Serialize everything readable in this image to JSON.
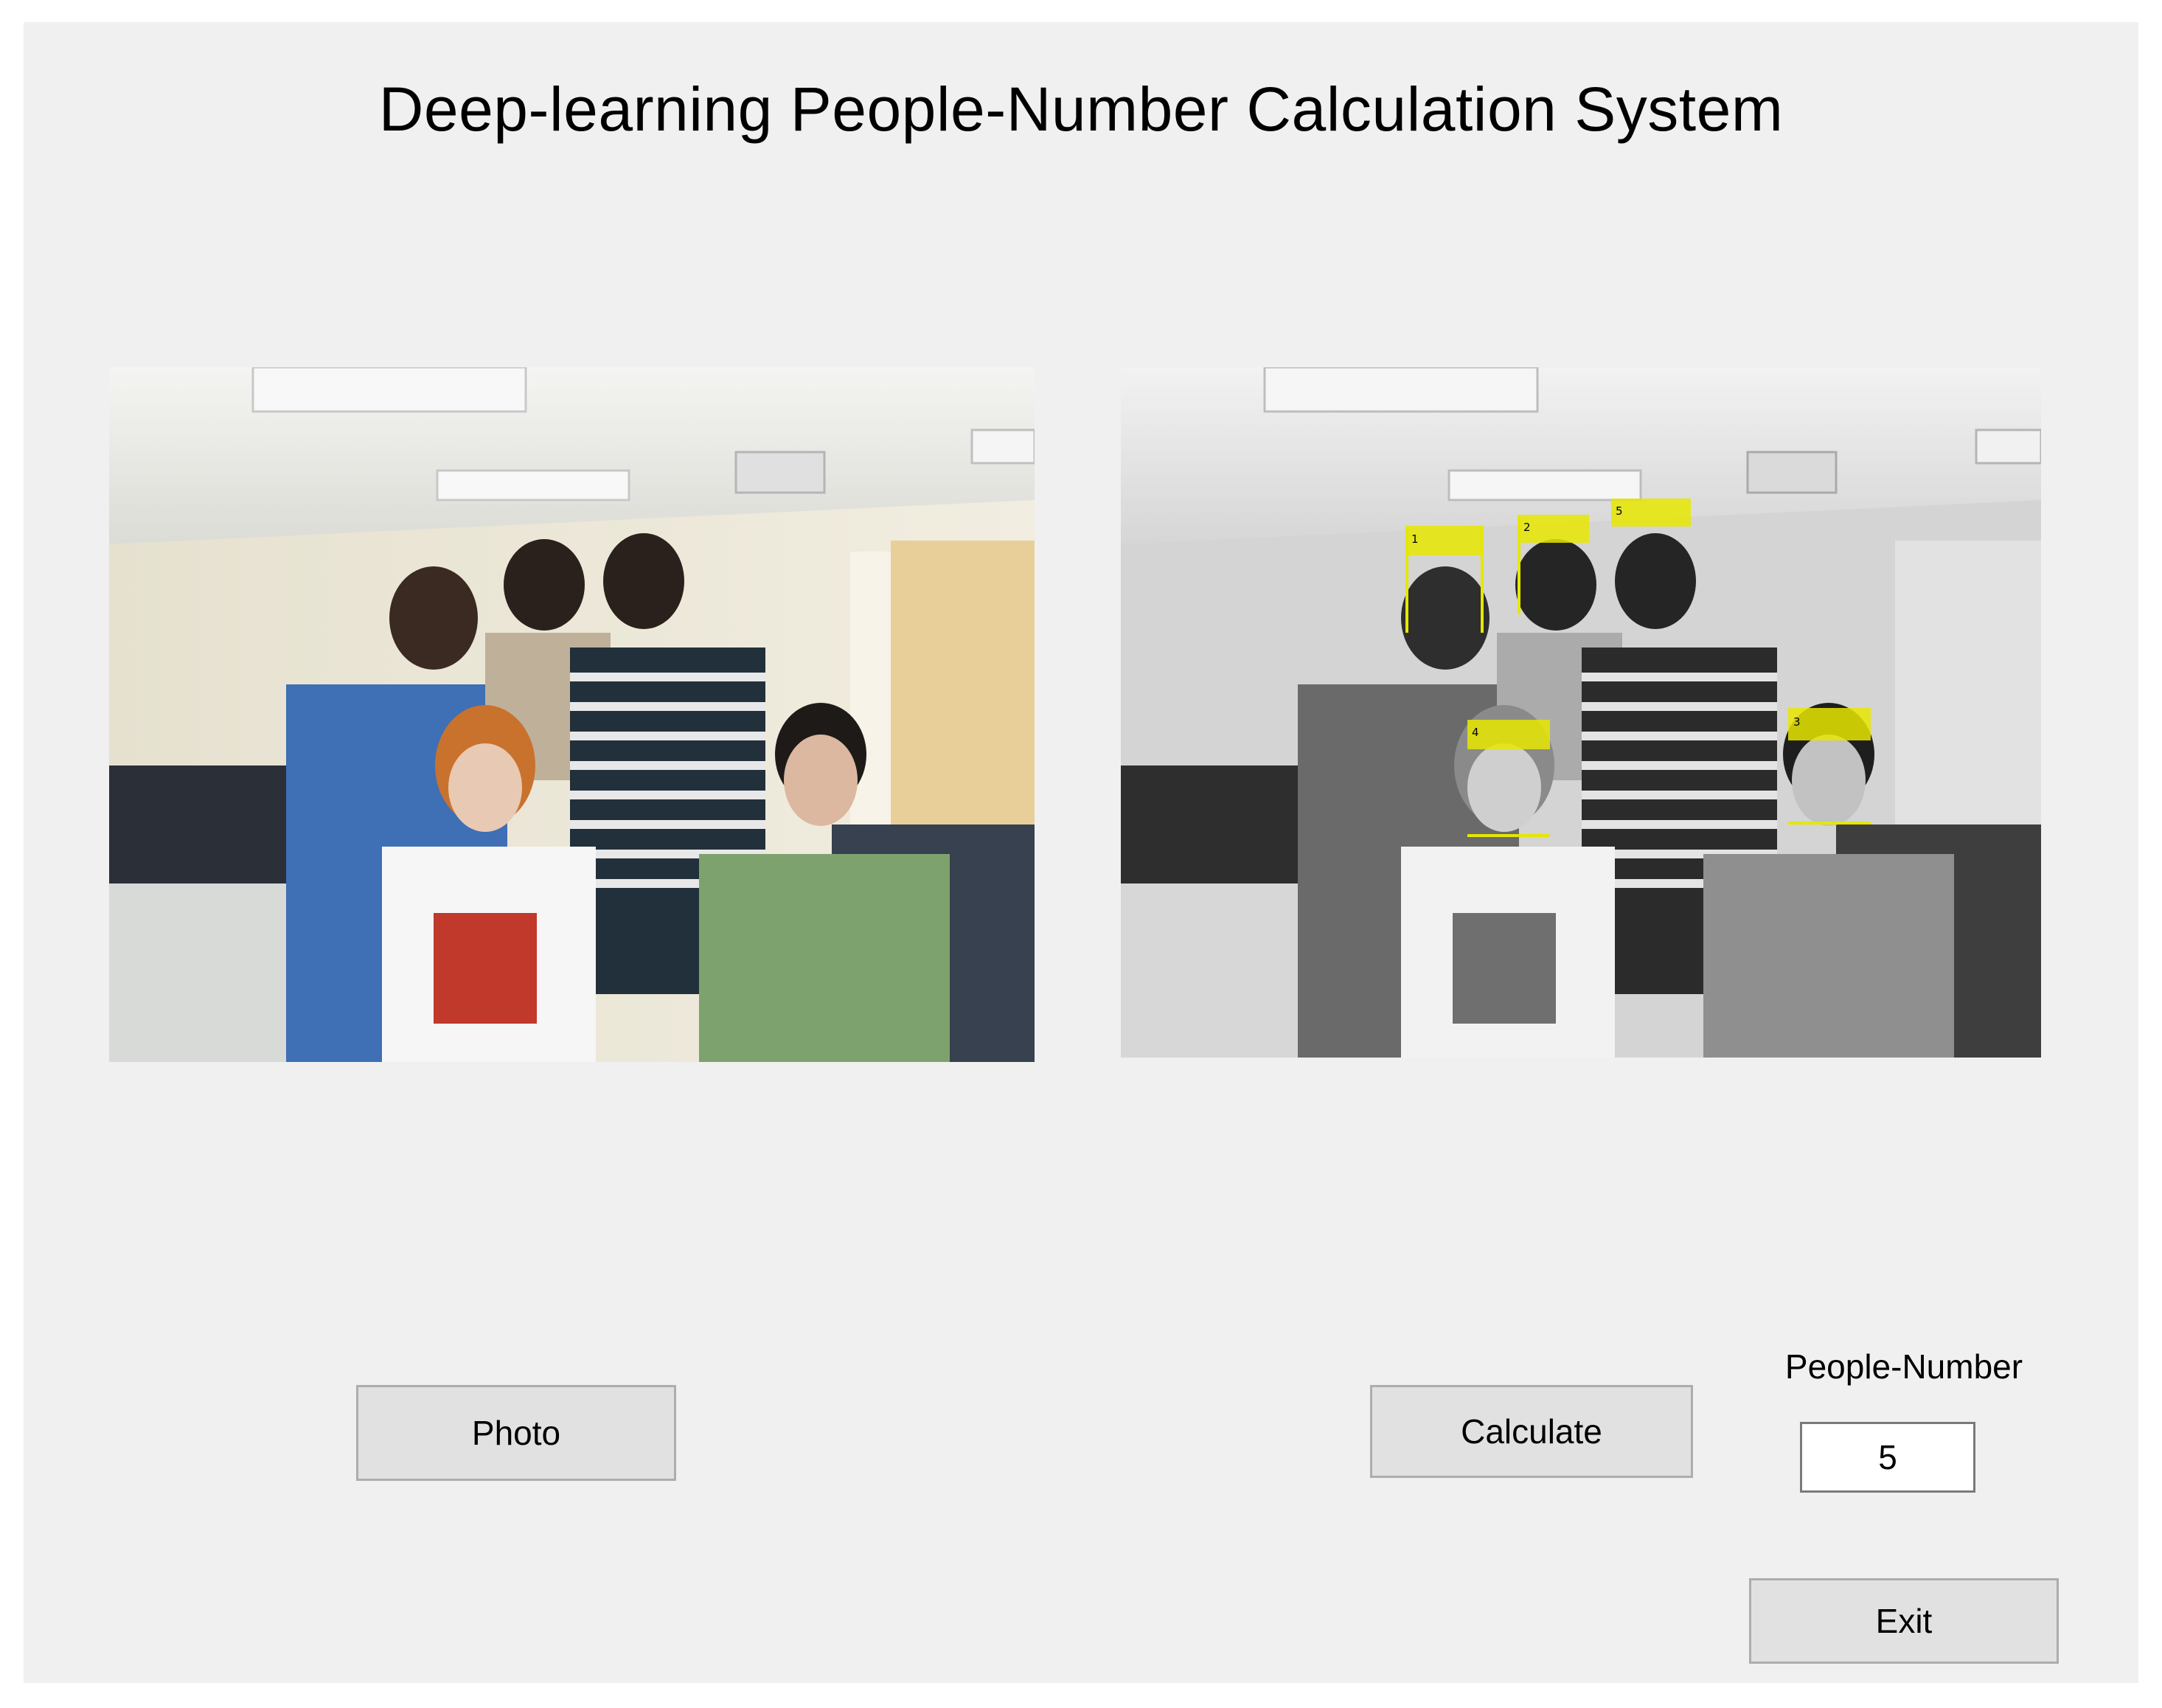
{
  "app": {
    "title": "Deep-learning People-Number Calculation System"
  },
  "images": {
    "original": "original-photo",
    "processed": "processed-photo-with-detections"
  },
  "detections": [
    {
      "label": "1"
    },
    {
      "label": "2"
    },
    {
      "label": "3"
    },
    {
      "label": "4"
    },
    {
      "label": "5"
    }
  ],
  "buttons": {
    "photo": "Photo",
    "calculate": "Calculate",
    "exit": "Exit"
  },
  "result": {
    "label": "People-Number",
    "value": "5"
  },
  "colors": {
    "window_bg": "#f0f0f0",
    "button_bg": "#e1e1e1",
    "detection_box": "#e6e600"
  }
}
